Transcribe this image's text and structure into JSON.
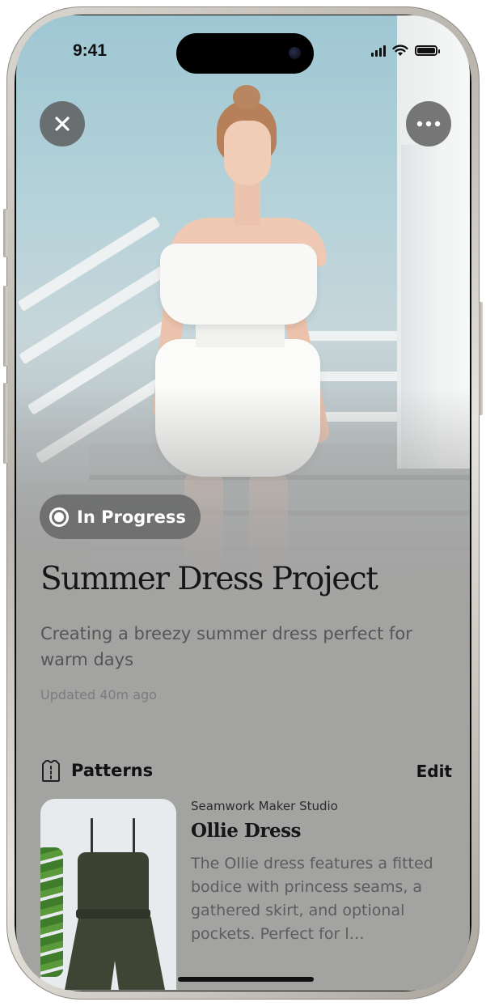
{
  "status_bar": {
    "time": "9:41",
    "icons": [
      "cellular-signal-icon",
      "wifi-icon",
      "battery-icon"
    ]
  },
  "hero": {
    "close_icon": "close-icon",
    "more_icon": "ellipsis-icon",
    "image": "photo of woman in white off-shoulder summer dress on white staircase"
  },
  "project": {
    "status": "In Progress",
    "title": "Summer Dress Project",
    "description": "Creating a breezy summer dress perfect for warm days",
    "updated": "Updated 40m ago"
  },
  "patterns": {
    "icon": "pattern-icon",
    "label": "Patterns",
    "edit_label": "Edit",
    "items": [
      {
        "source": "Seamwork Maker Studio",
        "name": "Ollie Dress",
        "description": "The Ollie dress features a fitted bodice with princess seams, a gathered skirt, and optional pockets. Perfect for l…"
      }
    ]
  },
  "colors": {
    "screen_background": "#a3a3a2",
    "badge_background": "#646464",
    "text_primary": "#161616",
    "text_secondary": "#555555"
  }
}
